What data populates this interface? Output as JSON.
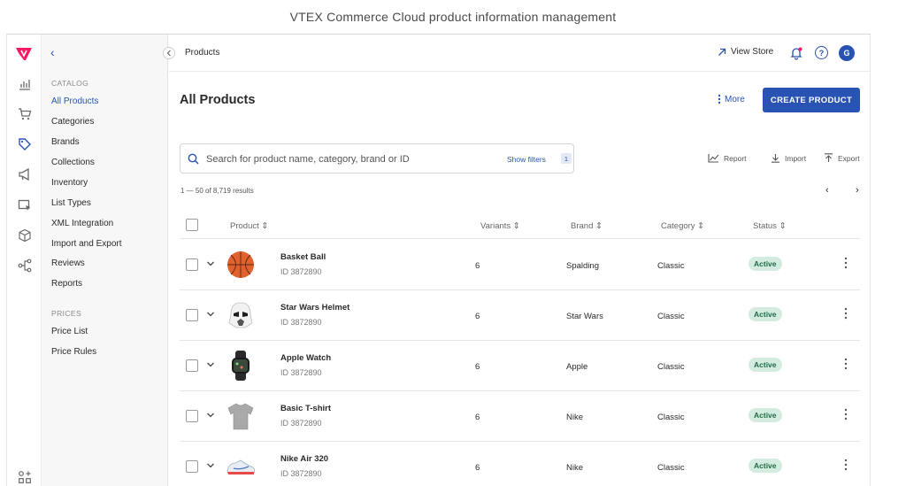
{
  "caption": "VTEX Commerce Cloud product information management",
  "icons": {
    "logo": "vtex-logo",
    "rail": [
      "chart-icon",
      "cart-icon",
      "tag-icon",
      "megaphone-icon",
      "cursor-icon",
      "box-icon",
      "hierarchy-icon",
      "apps-icon"
    ]
  },
  "sidebar": {
    "back": "‹",
    "catalog_heading": "CATALOG",
    "catalog_items": [
      "All Products",
      "Categories",
      "Brands",
      "Collections",
      "Inventory",
      "List Types",
      "XML Integration",
      "Import and Export",
      "Reviews",
      "Reports"
    ],
    "prices_heading": "PRICES",
    "price_items": [
      "Price List",
      "Price Rules"
    ]
  },
  "topbar": {
    "breadcrumb": "Products",
    "view_store": "View Store",
    "help": "?",
    "avatar": "G"
  },
  "header": {
    "title": "All Products",
    "more": "More",
    "create": "CREATE PRODUCT"
  },
  "search": {
    "placeholder": "Search for product name, category, brand or ID",
    "show_filters": "Show filters",
    "filter_count": "1"
  },
  "tools": {
    "report": "Report",
    "import": "Import",
    "export": "Export"
  },
  "results_text": "1 — 50 of 8,719 results",
  "pager": {
    "prev": "‹",
    "next": "›"
  },
  "table": {
    "columns": {
      "product": "Product ⇕",
      "variants": "Variants ⇕",
      "brand": "Brand ⇕",
      "category": "Category ⇕",
      "status": "Status ⇕"
    },
    "rows": [
      {
        "name": "Basket Ball",
        "id": "ID 3872890",
        "variants": "6",
        "brand": "Spalding",
        "category": "Classic",
        "status": "Active"
      },
      {
        "name": "Star Wars Helmet",
        "id": "ID 3872890",
        "variants": "6",
        "brand": "Star Wars",
        "category": "Classic",
        "status": "Active"
      },
      {
        "name": "Apple Watch",
        "id": "ID 3872890",
        "variants": "6",
        "brand": "Apple",
        "category": "Classic",
        "status": "Active"
      },
      {
        "name": "Basic T-shirt",
        "id": "ID 3872890",
        "variants": "6",
        "brand": "Nike",
        "category": "Classic",
        "status": "Active"
      },
      {
        "name": "Nike Air 320",
        "id": "ID 3872890",
        "variants": "6",
        "brand": "Nike",
        "category": "Classic",
        "status": "Active"
      }
    ]
  },
  "colors": {
    "accent": "#2953b2",
    "brand_pink": "#f71963",
    "active_badge_bg": "#d4ecdf",
    "active_badge_text": "#1f6b46"
  }
}
